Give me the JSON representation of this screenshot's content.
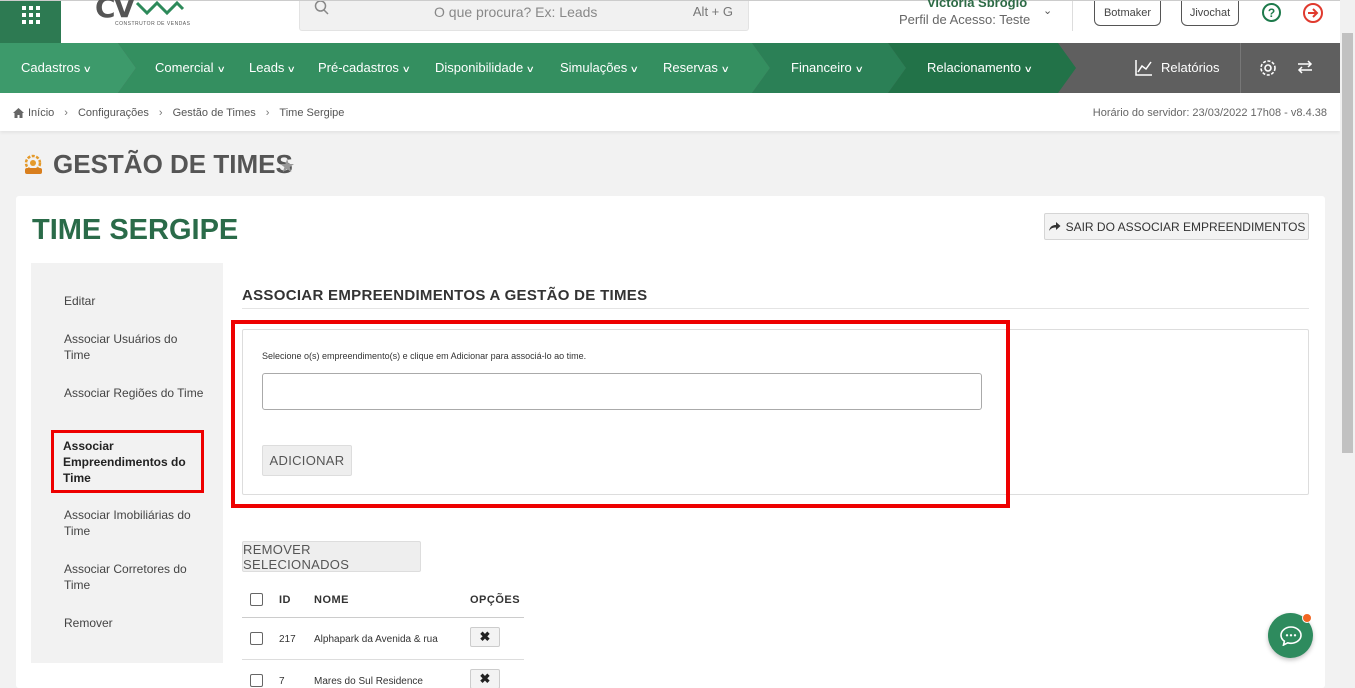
{
  "header": {
    "logo_text": "CV",
    "logo_subtitle": "CONSTRUTOR DE VENDAS",
    "search_placeholder": "O que procura? Ex: Leads",
    "search_shortcut": "Alt + G",
    "user_name": "Victoria Sbrogio",
    "user_profile": "Perfil de Acesso: Teste",
    "botmaker_label": "Botmaker",
    "jivochat_label": "Jivochat"
  },
  "nav": {
    "items": [
      {
        "label": "Cadastros"
      },
      {
        "label": "Comercial"
      },
      {
        "label": "Leads"
      },
      {
        "label": "Pré-cadastros"
      },
      {
        "label": "Disponibilidade"
      },
      {
        "label": "Simulações"
      },
      {
        "label": "Reservas"
      },
      {
        "label": "Financeiro"
      },
      {
        "label": "Relacionamento"
      }
    ],
    "reports_label": "Relatórios",
    "colors": {
      "seg1": "#3d9a6b",
      "seg2": "#348f60",
      "seg3": "#2b8056",
      "seg4": "#227248",
      "tools": "#5f5f5f"
    }
  },
  "breadcrumb": {
    "items": [
      "Início",
      "Configurações",
      "Gestão de Times",
      "Time Sergipe"
    ],
    "server_time": "Horário do servidor: 23/03/2022 17h08 - v8.4.38"
  },
  "page": {
    "title": "GESTÃO DE TIMES",
    "team_title": "TIME SERGIPE",
    "exit_button": "SAIR DO ASSOCIAR EMPREENDIMENTOS"
  },
  "sidemenu": {
    "items": [
      {
        "label": "Editar"
      },
      {
        "label": "Associar Usuários do Time"
      },
      {
        "label": "Associar Regiões do Time"
      },
      {
        "label": "Associar Empreendimentos do Time"
      },
      {
        "label": "Associar Imobiliárias do Time"
      },
      {
        "label": "Associar Corretores do Time"
      },
      {
        "label": "Remover"
      }
    ]
  },
  "section": {
    "title": "ASSOCIAR EMPREENDIMENTOS A GESTÃO DE TIMES",
    "hint": "Selecione o(s) empreendimento(s) e clique em Adicionar para associá-lo ao time.",
    "input_value": "",
    "add_button": "ADICIONAR",
    "remove_button": "REMOVER SELECIONADOS"
  },
  "table": {
    "headers": {
      "id": "ID",
      "name": "NOME",
      "options": "OPÇÕES"
    },
    "rows": [
      {
        "id": "217",
        "name": "Alphapark da Avenida & rua"
      },
      {
        "id": "7",
        "name": "Mares do Sul Residence"
      }
    ]
  }
}
